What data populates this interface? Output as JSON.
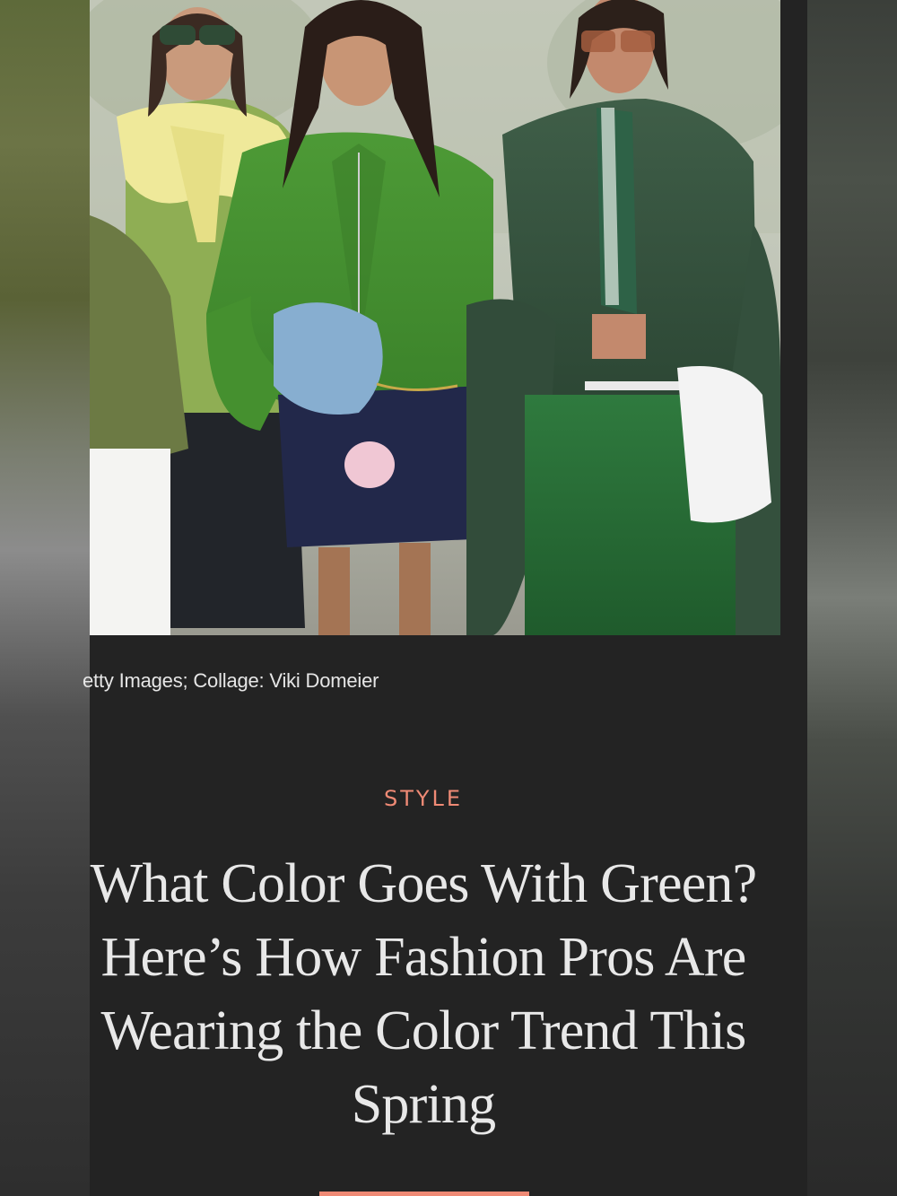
{
  "article": {
    "image_credit": "etty Images; Collage: Viki Domeier",
    "category": "STYLE",
    "headline": "What Color Goes With Green? Here’s How Fashion Pros Are Wearing the Color Trend This Spring"
  },
  "hero_image": {
    "alt": "three women in green outfits"
  },
  "colors": {
    "background": "#232323",
    "accent": "#ef8a75",
    "headline_text": "#e8e8e8",
    "credit_text": "#e6e6e6"
  }
}
